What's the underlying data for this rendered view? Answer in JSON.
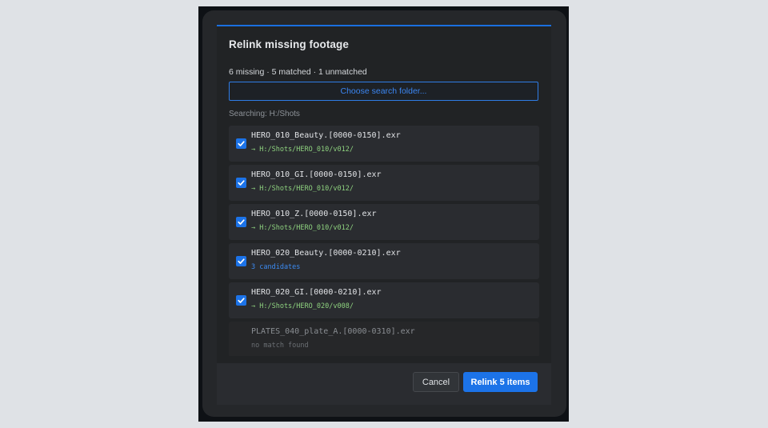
{
  "dialog": {
    "title": "Relink missing footage",
    "summary": "6 missing · 5 matched · 1 unmatched",
    "choose_folder_label": "Choose search folder...",
    "searching_label": "Searching: H:/Shots"
  },
  "items": [
    {
      "name": "HERO_010_Beauty.[0000-0150].exr",
      "detail": "→ H:/Shots/HERO_010/v012/",
      "checked": true,
      "status": "matched"
    },
    {
      "name": "HERO_010_GI.[0000-0150].exr",
      "detail": "→ H:/Shots/HERO_010/v012/",
      "checked": true,
      "status": "matched"
    },
    {
      "name": "HERO_010_Z.[0000-0150].exr",
      "detail": "→ H:/Shots/HERO_010/v012/",
      "checked": true,
      "status": "matched"
    },
    {
      "name": "HERO_020_Beauty.[0000-0210].exr",
      "detail": "3 candidates",
      "checked": true,
      "status": "candidates"
    },
    {
      "name": "HERO_020_GI.[0000-0210].exr",
      "detail": "→ H:/Shots/HERO_020/v008/",
      "checked": true,
      "status": "matched"
    },
    {
      "name": "PLATES_040_plate_A.[0000-0310].exr",
      "detail": "no match found",
      "checked": false,
      "status": "unmatched"
    }
  ],
  "footer": {
    "cancel_label": "Cancel",
    "relink_label": "Relink 5 items"
  },
  "colors": {
    "accent": "#1c73e8",
    "matched_path": "#8ed27f",
    "candidates": "#3c8bf3",
    "unmatched": "#6b6f74"
  },
  "icons": {
    "checkbox": "checkmark-icon"
  }
}
